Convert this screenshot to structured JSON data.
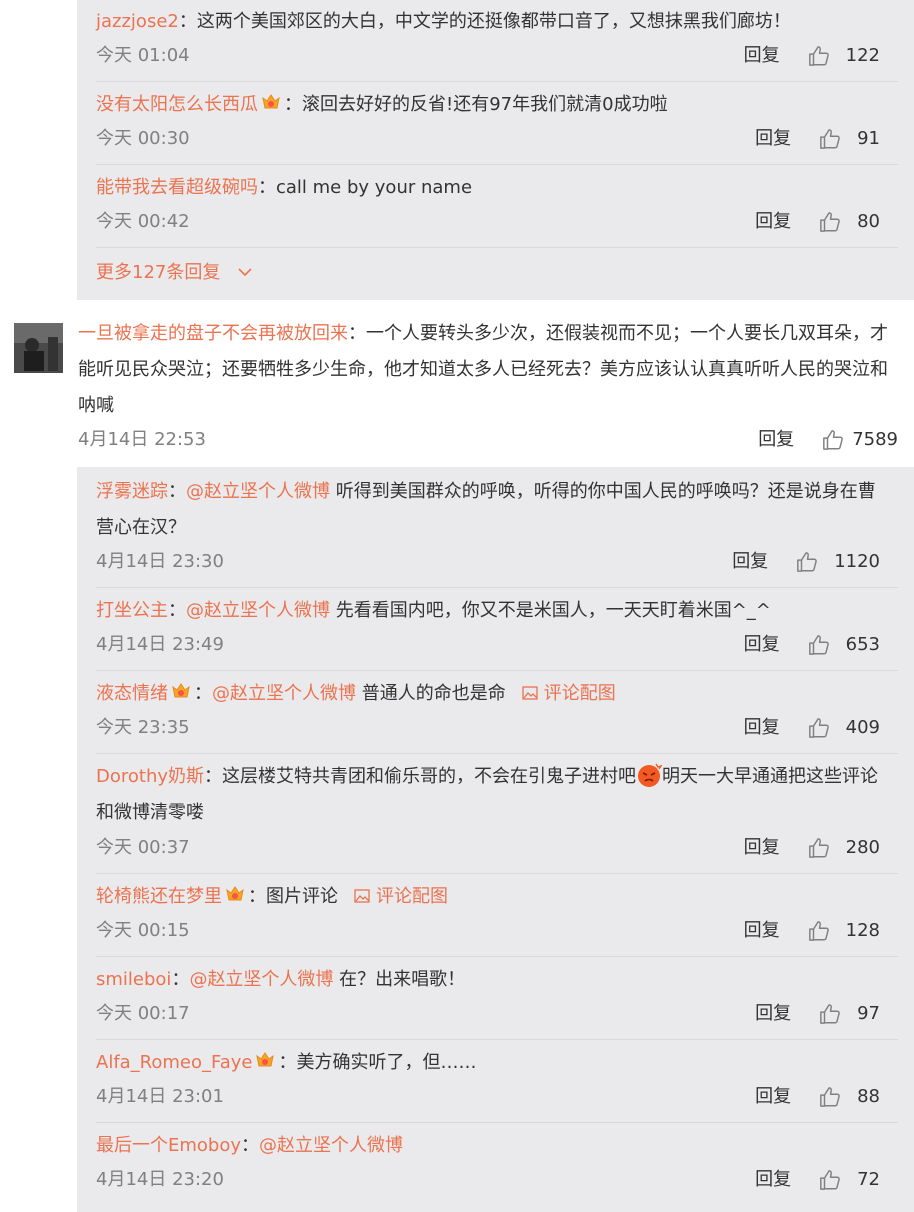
{
  "colors": {
    "accent": "#eb7350",
    "panel": "#eaeaec",
    "muted": "#808080",
    "text": "#333333"
  },
  "reply_label": "回复",
  "top_replies": [
    {
      "user": "jazzjose2",
      "has_badge": false,
      "mention": "",
      "text": "：这两个美国郊区的大白，中文学的还挺像都带口音了，又想抹黑我们廊坊！",
      "time": "今天 01:04",
      "likes": "122"
    },
    {
      "user": "没有太阳怎么长西瓜",
      "has_badge": true,
      "mention": "",
      "text": "：滚回去好好的反省!还有97年我们就清0成功啦",
      "time": "今天 00:30",
      "likes": "91"
    },
    {
      "user": "能带我去看超级碗吗",
      "has_badge": false,
      "mention": "",
      "text": "：call me by your name",
      "time": "今天 00:42",
      "likes": "80"
    }
  ],
  "more_replies": "更多127条回复",
  "main_comment": {
    "avatar_icon": "avatar-photo",
    "user": "一旦被拿走的盘子不会再被放回来",
    "text": "：一个人要转头多少次，还假装视而不见；一个人要长几双耳朵，才能听见民众哭泣；还要牺牲多少生命，他才知道太多人已经死去？美方应该认认真真听听人民的哭泣和呐喊",
    "time": "4月14日 22:53",
    "likes": "7589"
  },
  "replies": [
    {
      "user": "浮雾迷踪",
      "has_badge": false,
      "sep": "：",
      "mention": "@赵立坚个人微博",
      "text": " 听得到美国群众的呼唤，听得的你中国人民的呼唤吗？还是说身在曹营心在汉？",
      "pic": "",
      "time": "4月14日 23:30",
      "likes": "1120"
    },
    {
      "user": "打坐公主",
      "has_badge": false,
      "sep": "：",
      "mention": "@赵立坚个人微博",
      "text": " 先看看国内吧，你又不是米国人，一天天盯着米国^_^",
      "pic": "",
      "time": "4月14日 23:49",
      "likes": "653"
    },
    {
      "user": "液态情绪",
      "has_badge": true,
      "sep": "：",
      "mention": "@赵立坚个人微博",
      "text": " 普通人的命也是命",
      "pic": "评论配图",
      "time": "今天 23:35",
      "likes": "409"
    },
    {
      "user": "Dorothy奶斯",
      "has_badge": false,
      "sep": "",
      "mention": "",
      "text": "：这层楼艾特共青团和偷乐哥的，不会在引鬼子进村吧",
      "emoji": "angry-emoji",
      "text2": "明天一大早通通把这些评论和微博清零喽",
      "pic": "",
      "time": "今天 00:37",
      "likes": "280"
    },
    {
      "user": "轮椅熊还在梦里",
      "has_badge": true,
      "sep": "",
      "mention": "",
      "text": "：图片评论",
      "pic": "评论配图",
      "time": "今天 00:15",
      "likes": "128"
    },
    {
      "user": "smileboi",
      "has_badge": false,
      "sep": "：",
      "mention": "@赵立坚个人微博",
      "text": " 在？出来唱歌！",
      "pic": "",
      "time": "今天 00:17",
      "likes": "97"
    },
    {
      "user": "Alfa_Romeo_Faye",
      "has_badge": true,
      "sep": "",
      "mention": "",
      "text": "：美方确实听了，但……",
      "pic": "",
      "time": "4月14日 23:01",
      "likes": "88"
    },
    {
      "user": "最后一个Emoboy",
      "has_badge": false,
      "sep": "：",
      "mention": "@赵立坚个人微博",
      "text": "",
      "pic": "",
      "time": "4月14日 23:20",
      "likes": "72"
    }
  ]
}
